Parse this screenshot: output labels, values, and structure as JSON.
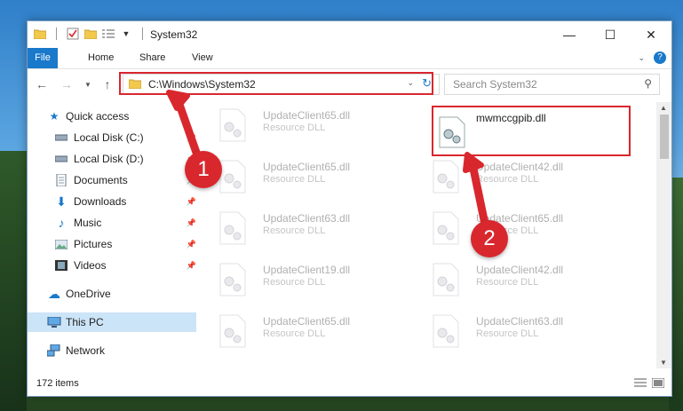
{
  "window": {
    "title": "System32"
  },
  "ribbon": {
    "tabs": [
      "File",
      "Home",
      "Share",
      "View"
    ]
  },
  "address": {
    "path": "C:\\Windows\\System32"
  },
  "search": {
    "placeholder": "Search System32"
  },
  "nav": {
    "quick_access": "Quick access",
    "items": [
      "Local Disk (C:)",
      "Local Disk (D:)",
      "Documents",
      "Downloads",
      "Music",
      "Pictures",
      "Videos"
    ],
    "onedrive": "OneDrive",
    "this_pc": "This PC",
    "network": "Network"
  },
  "files": {
    "type_label": "Resource DLL",
    "col1": [
      "UpdateClient65.dll",
      "UpdateClient65.dll",
      "UpdateClient63.dll",
      "UpdateClient19.dll",
      "UpdateClient65.dll"
    ],
    "col2": [
      "UpdateClient42.dll",
      "UpdateClient65.dll",
      "UpdateClient42.dll",
      "UpdateClient63.dll"
    ],
    "target": "mwmccgpib.dll"
  },
  "status": {
    "item_count": "172 items"
  },
  "annotations": {
    "step1": "1",
    "step2": "2"
  },
  "colors": {
    "accent": "#1979ca",
    "highlight": "#d9272e"
  }
}
